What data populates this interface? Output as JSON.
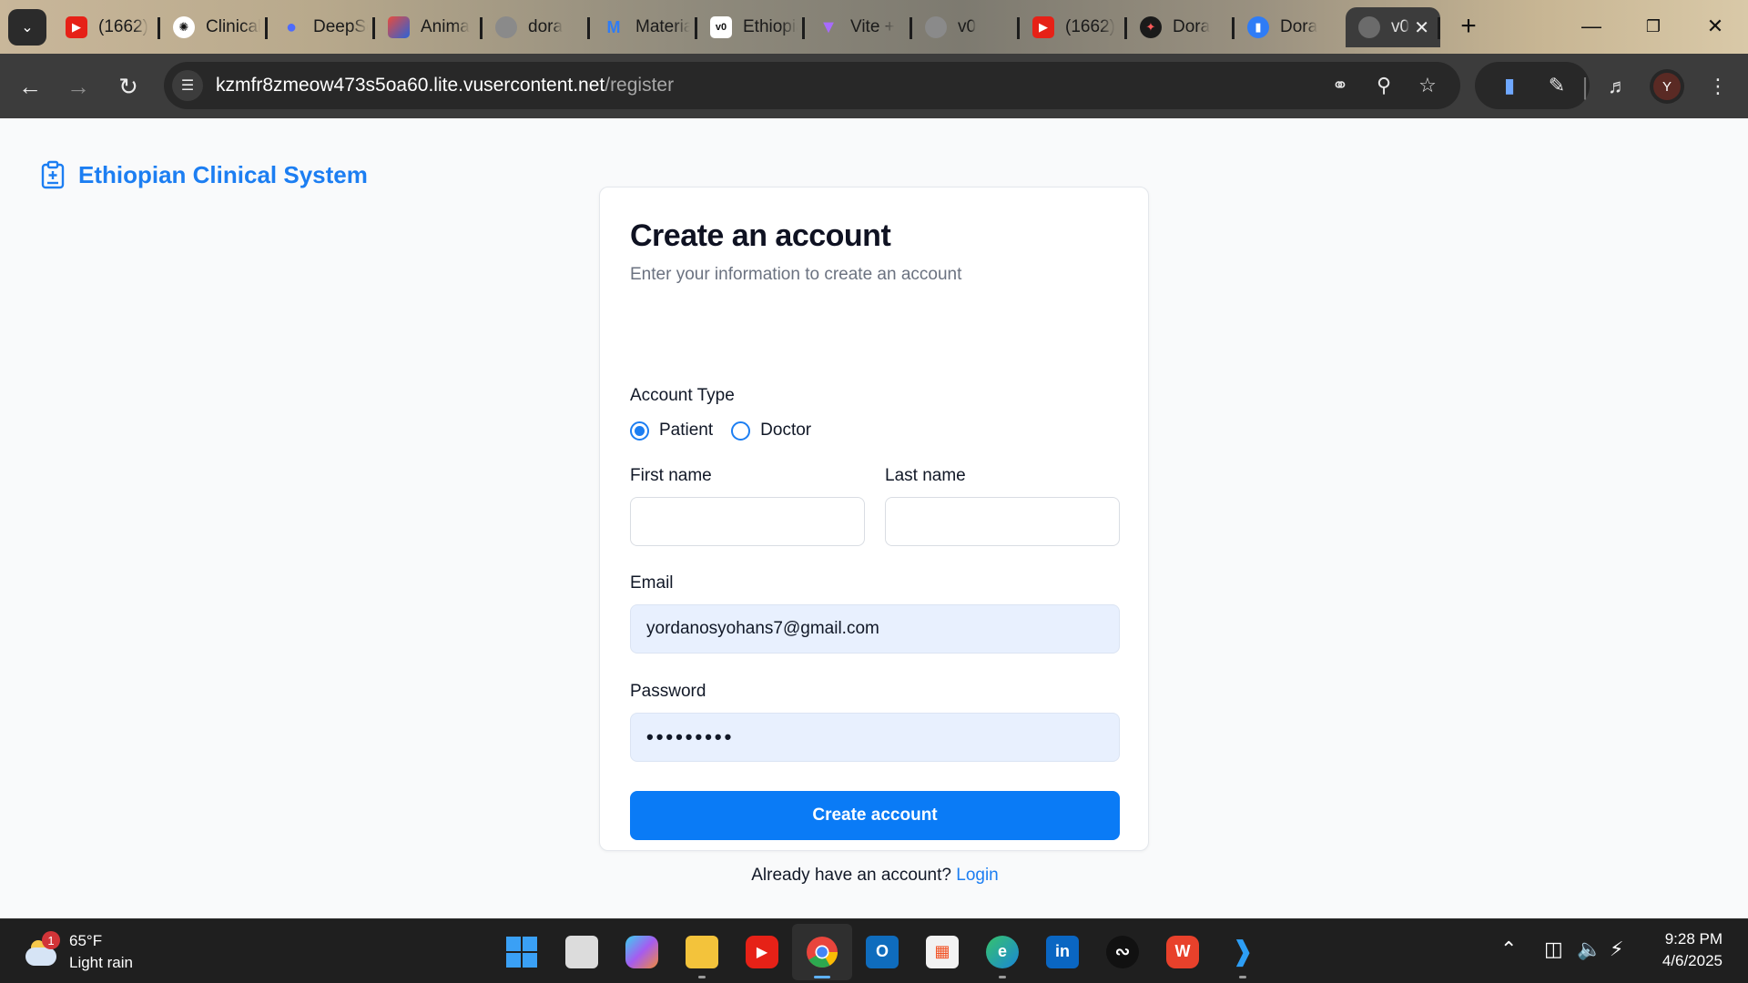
{
  "browser": {
    "tabs": [
      {
        "title": "(1662)",
        "icon": "youtube-icon",
        "color": "#e62117"
      },
      {
        "title": "Clinical",
        "icon": "chatgpt-icon",
        "color": "#ffffff"
      },
      {
        "title": "DeepSeek",
        "icon": "deepseek-icon",
        "color": "#4d6bfe"
      },
      {
        "title": "Anima",
        "icon": "anima-icon",
        "color": "#e94b3c"
      },
      {
        "title": "dora",
        "icon": "globe-icon",
        "color": "#8a8a8a"
      },
      {
        "title": "Material",
        "icon": "mui-icon",
        "color": "#2f7cf6"
      },
      {
        "title": "Ethiopian",
        "icon": "v0-icon",
        "color": "#ffffff"
      },
      {
        "title": "Vite +",
        "icon": "vite-icon",
        "color": "#a86bff"
      },
      {
        "title": "v0",
        "icon": "globe-icon",
        "color": "#8a8a8a"
      },
      {
        "title": "(1662)",
        "icon": "youtube-icon",
        "color": "#e62117"
      },
      {
        "title": "Dora",
        "icon": "dora-icon",
        "color": "#1a1a1a"
      },
      {
        "title": "Dora",
        "icon": "dora-blue-icon",
        "color": "#2f7cf6"
      }
    ],
    "active_tab": {
      "title": "v0",
      "icon": "globe-icon"
    },
    "url_host": "kzmfr8zmeow473s5oa60.lite.vusercontent.net",
    "url_path": "/register",
    "profile_initial": "Y"
  },
  "app": {
    "brand": "Ethiopian Clinical System",
    "brand_color": "#1c7ef2"
  },
  "form": {
    "title": "Create an account",
    "subtitle": "Enter your information to create an account",
    "account_type_label": "Account Type",
    "account_types": [
      {
        "label": "Patient",
        "selected": true
      },
      {
        "label": "Doctor",
        "selected": false
      }
    ],
    "first_name_label": "First name",
    "first_name_value": "",
    "last_name_label": "Last name",
    "last_name_value": "",
    "email_label": "Email",
    "email_value": "yordanosyohans7@gmail.com",
    "password_label": "Password",
    "password_value": "•••••••••",
    "submit_label": "Create account",
    "submit_color": "#0a7bf6",
    "login_prompt": "Already have an account?",
    "login_link": "Login"
  },
  "taskbar": {
    "weather_temp": "65°F",
    "weather_desc": "Light rain",
    "weather_badge": "1",
    "time": "9:28 PM",
    "date": "4/6/2025"
  }
}
